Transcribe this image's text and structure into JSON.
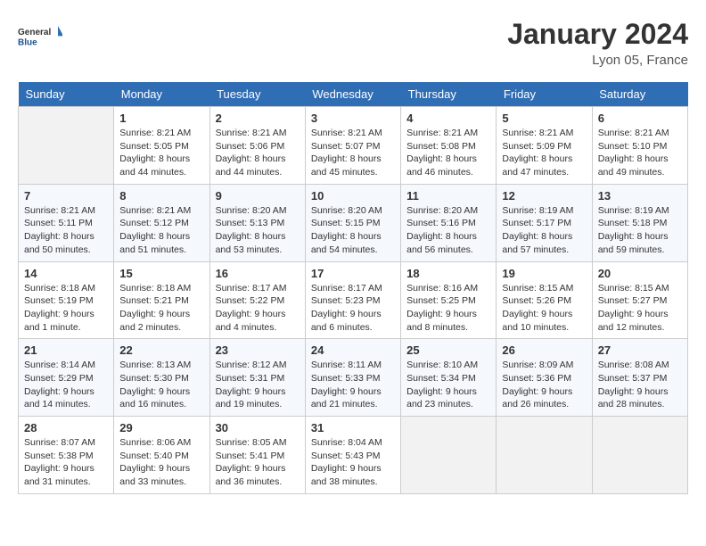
{
  "header": {
    "logo_line1": "General",
    "logo_line2": "Blue",
    "month": "January 2024",
    "location": "Lyon 05, France"
  },
  "days_of_week": [
    "Sunday",
    "Monday",
    "Tuesday",
    "Wednesday",
    "Thursday",
    "Friday",
    "Saturday"
  ],
  "weeks": [
    [
      {
        "day": "",
        "sunrise": "",
        "sunset": "",
        "daylight": ""
      },
      {
        "day": "1",
        "sunrise": "Sunrise: 8:21 AM",
        "sunset": "Sunset: 5:05 PM",
        "daylight": "Daylight: 8 hours and 44 minutes."
      },
      {
        "day": "2",
        "sunrise": "Sunrise: 8:21 AM",
        "sunset": "Sunset: 5:06 PM",
        "daylight": "Daylight: 8 hours and 44 minutes."
      },
      {
        "day": "3",
        "sunrise": "Sunrise: 8:21 AM",
        "sunset": "Sunset: 5:07 PM",
        "daylight": "Daylight: 8 hours and 45 minutes."
      },
      {
        "day": "4",
        "sunrise": "Sunrise: 8:21 AM",
        "sunset": "Sunset: 5:08 PM",
        "daylight": "Daylight: 8 hours and 46 minutes."
      },
      {
        "day": "5",
        "sunrise": "Sunrise: 8:21 AM",
        "sunset": "Sunset: 5:09 PM",
        "daylight": "Daylight: 8 hours and 47 minutes."
      },
      {
        "day": "6",
        "sunrise": "Sunrise: 8:21 AM",
        "sunset": "Sunset: 5:10 PM",
        "daylight": "Daylight: 8 hours and 49 minutes."
      }
    ],
    [
      {
        "day": "7",
        "sunrise": "Sunrise: 8:21 AM",
        "sunset": "Sunset: 5:11 PM",
        "daylight": "Daylight: 8 hours and 50 minutes."
      },
      {
        "day": "8",
        "sunrise": "Sunrise: 8:21 AM",
        "sunset": "Sunset: 5:12 PM",
        "daylight": "Daylight: 8 hours and 51 minutes."
      },
      {
        "day": "9",
        "sunrise": "Sunrise: 8:20 AM",
        "sunset": "Sunset: 5:13 PM",
        "daylight": "Daylight: 8 hours and 53 minutes."
      },
      {
        "day": "10",
        "sunrise": "Sunrise: 8:20 AM",
        "sunset": "Sunset: 5:15 PM",
        "daylight": "Daylight: 8 hours and 54 minutes."
      },
      {
        "day": "11",
        "sunrise": "Sunrise: 8:20 AM",
        "sunset": "Sunset: 5:16 PM",
        "daylight": "Daylight: 8 hours and 56 minutes."
      },
      {
        "day": "12",
        "sunrise": "Sunrise: 8:19 AM",
        "sunset": "Sunset: 5:17 PM",
        "daylight": "Daylight: 8 hours and 57 minutes."
      },
      {
        "day": "13",
        "sunrise": "Sunrise: 8:19 AM",
        "sunset": "Sunset: 5:18 PM",
        "daylight": "Daylight: 8 hours and 59 minutes."
      }
    ],
    [
      {
        "day": "14",
        "sunrise": "Sunrise: 8:18 AM",
        "sunset": "Sunset: 5:19 PM",
        "daylight": "Daylight: 9 hours and 1 minute."
      },
      {
        "day": "15",
        "sunrise": "Sunrise: 8:18 AM",
        "sunset": "Sunset: 5:21 PM",
        "daylight": "Daylight: 9 hours and 2 minutes."
      },
      {
        "day": "16",
        "sunrise": "Sunrise: 8:17 AM",
        "sunset": "Sunset: 5:22 PM",
        "daylight": "Daylight: 9 hours and 4 minutes."
      },
      {
        "day": "17",
        "sunrise": "Sunrise: 8:17 AM",
        "sunset": "Sunset: 5:23 PM",
        "daylight": "Daylight: 9 hours and 6 minutes."
      },
      {
        "day": "18",
        "sunrise": "Sunrise: 8:16 AM",
        "sunset": "Sunset: 5:25 PM",
        "daylight": "Daylight: 9 hours and 8 minutes."
      },
      {
        "day": "19",
        "sunrise": "Sunrise: 8:15 AM",
        "sunset": "Sunset: 5:26 PM",
        "daylight": "Daylight: 9 hours and 10 minutes."
      },
      {
        "day": "20",
        "sunrise": "Sunrise: 8:15 AM",
        "sunset": "Sunset: 5:27 PM",
        "daylight": "Daylight: 9 hours and 12 minutes."
      }
    ],
    [
      {
        "day": "21",
        "sunrise": "Sunrise: 8:14 AM",
        "sunset": "Sunset: 5:29 PM",
        "daylight": "Daylight: 9 hours and 14 minutes."
      },
      {
        "day": "22",
        "sunrise": "Sunrise: 8:13 AM",
        "sunset": "Sunset: 5:30 PM",
        "daylight": "Daylight: 9 hours and 16 minutes."
      },
      {
        "day": "23",
        "sunrise": "Sunrise: 8:12 AM",
        "sunset": "Sunset: 5:31 PM",
        "daylight": "Daylight: 9 hours and 19 minutes."
      },
      {
        "day": "24",
        "sunrise": "Sunrise: 8:11 AM",
        "sunset": "Sunset: 5:33 PM",
        "daylight": "Daylight: 9 hours and 21 minutes."
      },
      {
        "day": "25",
        "sunrise": "Sunrise: 8:10 AM",
        "sunset": "Sunset: 5:34 PM",
        "daylight": "Daylight: 9 hours and 23 minutes."
      },
      {
        "day": "26",
        "sunrise": "Sunrise: 8:09 AM",
        "sunset": "Sunset: 5:36 PM",
        "daylight": "Daylight: 9 hours and 26 minutes."
      },
      {
        "day": "27",
        "sunrise": "Sunrise: 8:08 AM",
        "sunset": "Sunset: 5:37 PM",
        "daylight": "Daylight: 9 hours and 28 minutes."
      }
    ],
    [
      {
        "day": "28",
        "sunrise": "Sunrise: 8:07 AM",
        "sunset": "Sunset: 5:38 PM",
        "daylight": "Daylight: 9 hours and 31 minutes."
      },
      {
        "day": "29",
        "sunrise": "Sunrise: 8:06 AM",
        "sunset": "Sunset: 5:40 PM",
        "daylight": "Daylight: 9 hours and 33 minutes."
      },
      {
        "day": "30",
        "sunrise": "Sunrise: 8:05 AM",
        "sunset": "Sunset: 5:41 PM",
        "daylight": "Daylight: 9 hours and 36 minutes."
      },
      {
        "day": "31",
        "sunrise": "Sunrise: 8:04 AM",
        "sunset": "Sunset: 5:43 PM",
        "daylight": "Daylight: 9 hours and 38 minutes."
      },
      {
        "day": "",
        "sunrise": "",
        "sunset": "",
        "daylight": ""
      },
      {
        "day": "",
        "sunrise": "",
        "sunset": "",
        "daylight": ""
      },
      {
        "day": "",
        "sunrise": "",
        "sunset": "",
        "daylight": ""
      }
    ]
  ]
}
